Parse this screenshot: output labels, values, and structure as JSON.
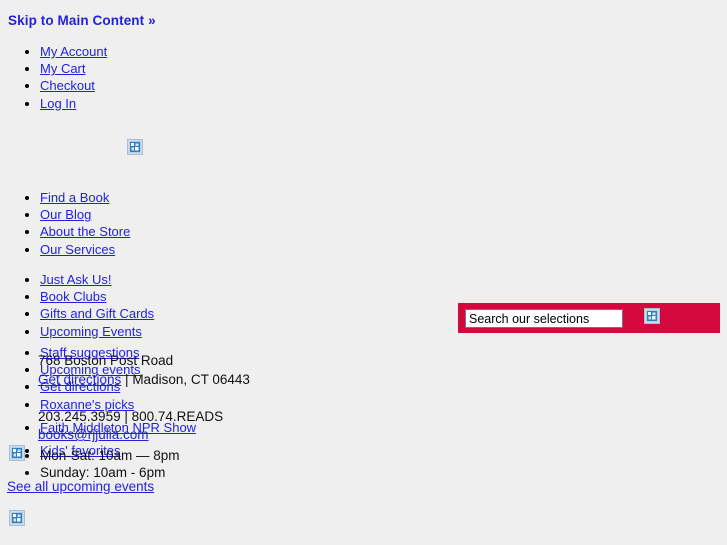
{
  "skip": {
    "label": "Skip to Main Content",
    "chevron": "»"
  },
  "account_nav": {
    "items": [
      {
        "label": "My Account"
      },
      {
        "label": "My Cart"
      },
      {
        "label": "Checkout"
      },
      {
        "label": "Log In"
      }
    ]
  },
  "logo": {
    "icon": "broken-image-icon",
    "alt": ""
  },
  "primary_nav": {
    "items": [
      {
        "label": "Find a Book"
      },
      {
        "label": "Our Blog"
      },
      {
        "label": "About the Store"
      },
      {
        "label": "Our Services"
      }
    ]
  },
  "secondary_nav": {
    "items": [
      {
        "label": "Just Ask Us!"
      },
      {
        "label": "Book Clubs"
      },
      {
        "label": "Gifts and Gift Cards"
      },
      {
        "label": "Upcoming Events"
      }
    ]
  },
  "staff_nav": {
    "items": [
      {
        "label": "Staff suggestions"
      },
      {
        "label": "Upcoming events"
      },
      {
        "label": "Get directions"
      },
      {
        "label": "Roxanne's picks"
      },
      {
        "label": "Faith Middleton NPR Show"
      },
      {
        "label": "Kids' favorites"
      }
    ]
  },
  "address": {
    "street": "768 Boston Post Road",
    "city_state_zip": "Madison, CT 06443",
    "directions_label": "Get directions",
    "separator": "|",
    "phone_local": "203.245.3959",
    "phone_toll_free": "800.74.READS",
    "email": "books@rjjulia.com"
  },
  "hours": {
    "icon": "broken-image-icon",
    "items": [
      {
        "label": "Mon-Sat: 10am — 8pm"
      },
      {
        "label": "Sunday: 10am - 6pm"
      }
    ]
  },
  "events_link": {
    "label": "See all upcoming events"
  },
  "bottom": {
    "icon": "broken-image-icon"
  },
  "search": {
    "value": "Search our selections",
    "placeholder": "Search our selections",
    "submit_icon": "broken-image-icon",
    "bar_color": "#d3083d"
  },
  "colors": {
    "page_background": "#efefef",
    "link": "#2222dd",
    "accent": "#d3083d",
    "text": "#000000"
  }
}
